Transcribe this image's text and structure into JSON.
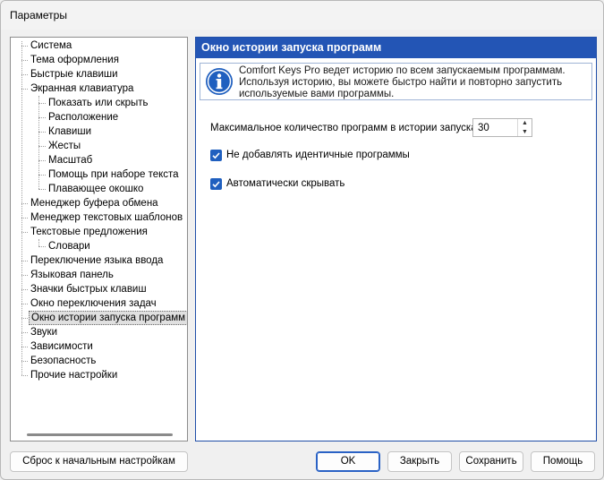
{
  "window": {
    "title": "Параметры"
  },
  "tree": {
    "items": [
      {
        "label": "Система",
        "level": 0
      },
      {
        "label": "Тема оформления",
        "level": 0
      },
      {
        "label": "Быстрые клавиши",
        "level": 0
      },
      {
        "label": "Экранная клавиатура",
        "level": 0
      },
      {
        "label": "Показать или скрыть",
        "level": 1
      },
      {
        "label": "Расположение",
        "level": 1
      },
      {
        "label": "Клавиши",
        "level": 1
      },
      {
        "label": "Жесты",
        "level": 1
      },
      {
        "label": "Масштаб",
        "level": 1
      },
      {
        "label": "Помощь при наборе текста",
        "level": 1
      },
      {
        "label": "Плавающее окошко",
        "level": 1
      },
      {
        "label": "Менеджер буфера обмена",
        "level": 0
      },
      {
        "label": "Менеджер текстовых шаблонов",
        "level": 0
      },
      {
        "label": "Текстовые предложения",
        "level": 0
      },
      {
        "label": "Словари",
        "level": 1
      },
      {
        "label": "Переключение языка ввода",
        "level": 0
      },
      {
        "label": "Языковая панель",
        "level": 0
      },
      {
        "label": "Значки быстрых клавиш",
        "level": 0
      },
      {
        "label": "Окно переключения задач",
        "level": 0
      },
      {
        "label": "Окно истории запуска программ",
        "level": 0,
        "selected": true
      },
      {
        "label": "Звуки",
        "level": 0
      },
      {
        "label": "Зависимости",
        "level": 0
      },
      {
        "label": "Безопасность",
        "level": 0
      },
      {
        "label": "Прочие настройки",
        "level": 0
      }
    ]
  },
  "panel": {
    "header": "Окно истории запуска программ",
    "info_icon": "info-icon",
    "info_lines": [
      "Comfort Keys Pro ведет историю по всем запускаемым программам.",
      "Используя историю, вы можете быстро найти и повторно запустить",
      "используемые вами программы."
    ],
    "max_label": "Максимальное количество программ в истории запуска:",
    "max_value": "30",
    "checkbox_no_duplicates": {
      "label": "Не добавлять идентичные программы",
      "checked": true
    },
    "checkbox_auto_hide": {
      "label": "Автоматически скрывать",
      "checked": true
    }
  },
  "buttons": {
    "reset": "Сброс к начальным настройкам",
    "ok": "OK",
    "close": "Закрыть",
    "save": "Сохранить",
    "help": "Помощь"
  },
  "colors": {
    "header_bg": "#2355b5",
    "checkbox": "#1f5fbf",
    "info_icon": "#1f5fbf"
  }
}
